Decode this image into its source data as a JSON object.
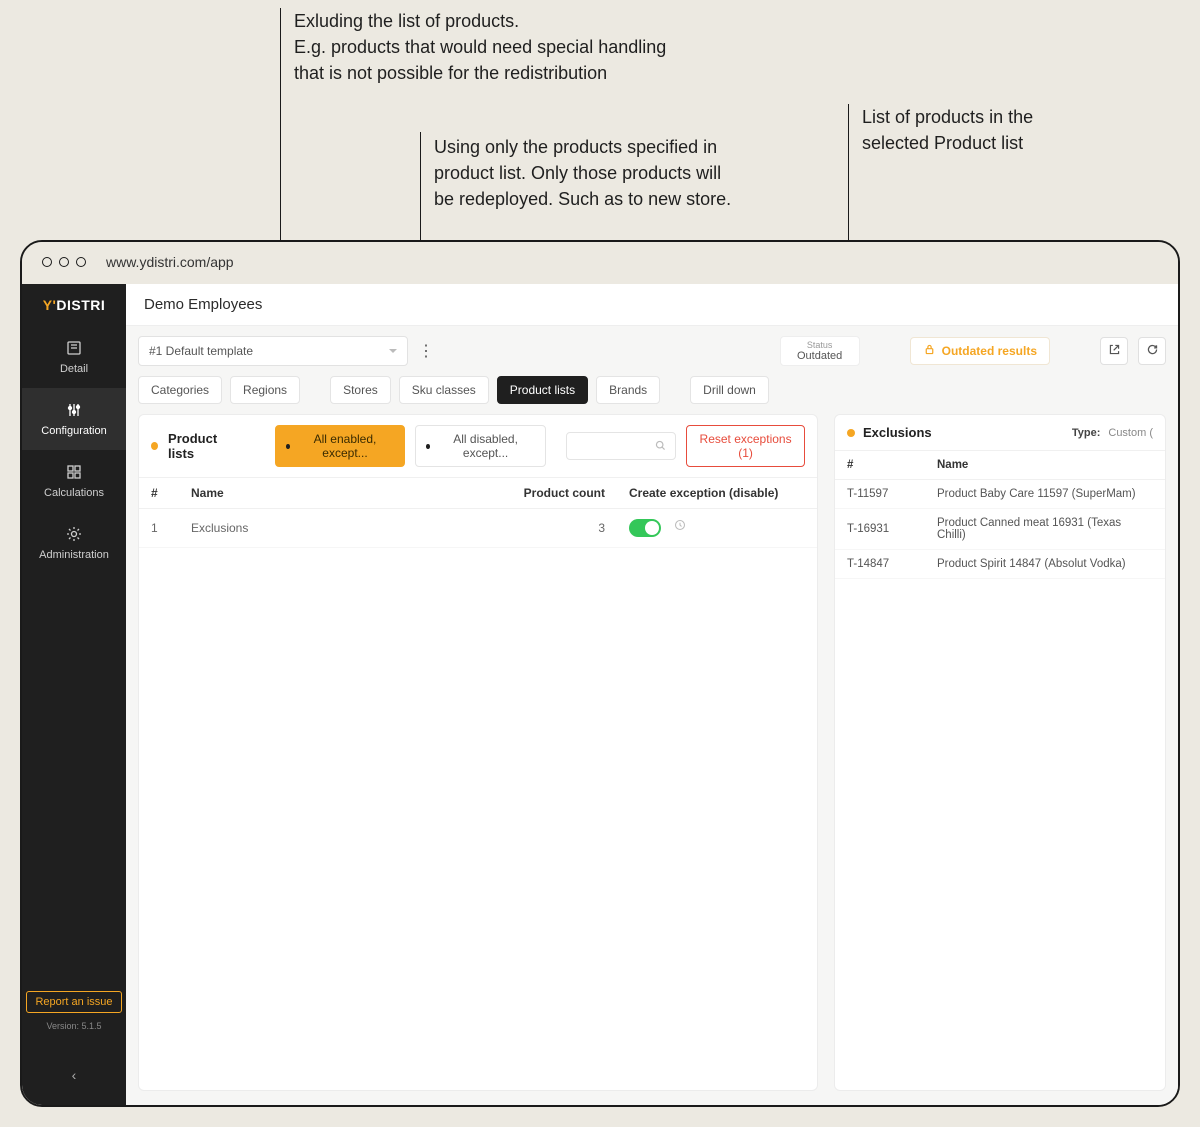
{
  "callouts": {
    "a": "Exluding the list of products.\nE.g. products that would need special handling\nthat is not possible for the redistribution",
    "b": "Using only the products specified in\nproduct list. Only those products will\nbe redeployed. Such as to new store.",
    "c": "List of products in the\nselected Product list"
  },
  "browser": {
    "url": "www.ydistri.com/app"
  },
  "brand": {
    "prefix": "Y'",
    "name": "DISTRI"
  },
  "sidebar": {
    "items": [
      {
        "label": "Detail"
      },
      {
        "label": "Configuration"
      },
      {
        "label": "Calculations"
      },
      {
        "label": "Administration"
      }
    ],
    "report": "Report an issue",
    "version": "Version: 5.1.5"
  },
  "header": {
    "title": "Demo Employees"
  },
  "toolbar": {
    "template": "#1  Default template",
    "status_label": "Status",
    "status_value": "Outdated",
    "outdated": "Outdated results"
  },
  "tabs": {
    "categories": "Categories",
    "regions": "Regions",
    "stores": "Stores",
    "sku": "Sku classes",
    "product_lists": "Product lists",
    "brands": "Brands",
    "drill": "Drill down"
  },
  "left_panel": {
    "title": "Product lists",
    "mode_enabled": "All enabled, except...",
    "mode_disabled": "All disabled, except...",
    "reset": "Reset exceptions (1)",
    "cols": {
      "idx": "#",
      "name": "Name",
      "count": "Product count",
      "exception": "Create exception (disable)"
    },
    "rows": [
      {
        "idx": "1",
        "name": "Exclusions",
        "count": "3"
      }
    ]
  },
  "right_panel": {
    "title": "Exclusions",
    "type_label": "Type:",
    "type_value": "Custom (",
    "cols": {
      "idx": "#",
      "name": "Name"
    },
    "rows": [
      {
        "id": "T-11597",
        "name": "Product Baby Care 11597 (SuperMam)"
      },
      {
        "id": "T-16931",
        "name": "Product Canned meat 16931 (Texas Chilli)"
      },
      {
        "id": "T-14847",
        "name": "Product Spirit 14847 (Absolut Vodka)"
      }
    ]
  }
}
